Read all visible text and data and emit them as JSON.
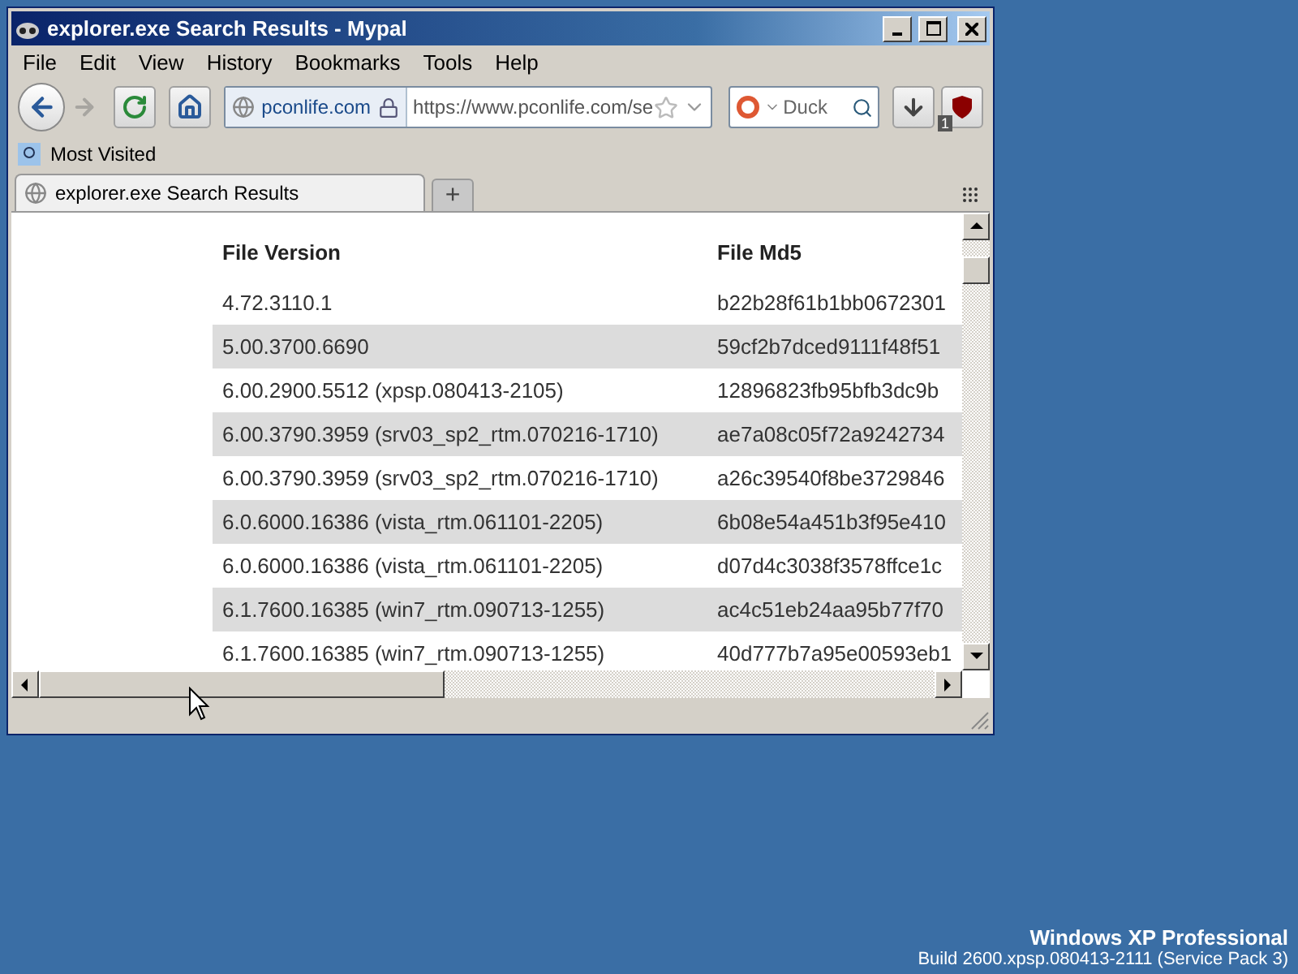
{
  "window": {
    "title": "explorer.exe Search Results - Mypal"
  },
  "menu": [
    "File",
    "Edit",
    "View",
    "History",
    "Bookmarks",
    "Tools",
    "Help"
  ],
  "nav": {
    "forward_disabled": true,
    "identity": "pconlife.com",
    "url": "https://www.pconlife.com/se",
    "search": "Duck",
    "addon_badge": "1"
  },
  "bookmarks": [
    "Most Visited"
  ],
  "tabs": [
    {
      "label": "explorer.exe Search Results",
      "selected": true
    }
  ],
  "new_tab": "+",
  "table": {
    "columns": [
      "File Version",
      "File Md5"
    ],
    "rows": [
      [
        "4.72.3110.1",
        "b22b28f61b1bb0672301"
      ],
      [
        "5.00.3700.6690",
        "59cf2b7dced9111f48f51"
      ],
      [
        "6.00.2900.5512 (xpsp.080413-2105)",
        "12896823fb95bfb3dc9b"
      ],
      [
        "6.00.3790.3959 (srv03_sp2_rtm.070216-1710)",
        "ae7a08c05f72a9242734"
      ],
      [
        "6.00.3790.3959 (srv03_sp2_rtm.070216-1710)",
        "a26c39540f8be3729846"
      ],
      [
        "6.0.6000.16386 (vista_rtm.061101-2205)",
        "6b08e54a451b3f95e410"
      ],
      [
        "6.0.6000.16386 (vista_rtm.061101-2205)",
        "d07d4c3038f3578ffce1c"
      ],
      [
        "6.1.7600.16385 (win7_rtm.090713-1255)",
        "ac4c51eb24aa95b77f70"
      ],
      [
        "6.1.7600.16385 (win7_rtm.090713-1255)",
        "40d777b7a95e00593eb1"
      ]
    ]
  },
  "desktop": {
    "edition": "Windows XP Professional",
    "build": "Build 2600.xpsp.080413-2111 (Service Pack 3)"
  }
}
